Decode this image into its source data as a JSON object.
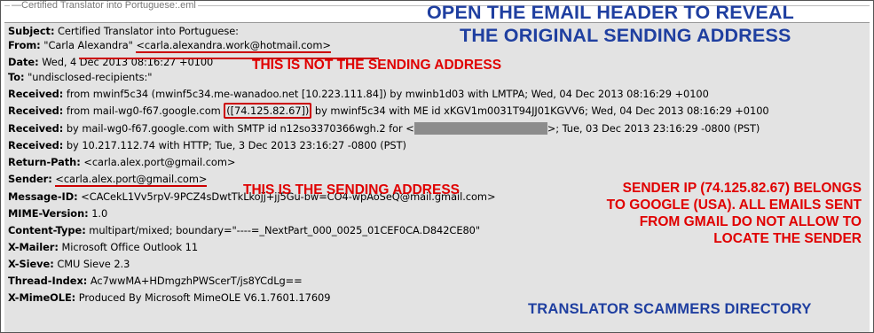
{
  "window": {
    "title": "Certified Translator into Portuguese:.eml"
  },
  "headers": [
    {
      "label": "Subject:",
      "value": "Certified Translator into Portuguese:"
    },
    {
      "label": "From:",
      "value": "\"Carla Alexandra\" ",
      "value2": "<carla.alexandra.work@hotmail.com>"
    },
    {
      "label": "Date:",
      "value": "Wed, 4 Dec 2013 08:16:27 +0100"
    },
    {
      "label": "To:",
      "value": "\"undisclosed-recipients:\""
    },
    {
      "label": "Received:",
      "value": "from mwinf5c34 (mwinf5c34.me-wanadoo.net [10.223.111.84]) by mwinb1d03 with LMTPA; Wed, 04 Dec 2013 08:16:29 +0100"
    },
    {
      "label": "Received:",
      "value": "from mail-wg0-f67.google.com ",
      "value2": "([74.125.82.67])",
      "value3": " by mwinf5c34 with ME id xKGV1m0031T94JJ01KGVV6; Wed, 04 Dec 2013 08:16:29 +0100"
    },
    {
      "label": "Received:",
      "value": "by mail-wg0-f67.google.com with SMTP id n12so3370366wgh.2 for <",
      "value3": ">; Tue, 03 Dec 2013 23:16:29 -0800 (PST)"
    },
    {
      "label": "Received:",
      "value": "by 10.217.112.74 with HTTP; Tue, 3 Dec 2013 23:16:27 -0800 (PST)"
    },
    {
      "label": "Return-Path:",
      "value": "<carla.alex.port@gmail.com>"
    },
    {
      "label": "Sender:",
      "value2": "<carla.alex.port@gmail.com>"
    },
    {
      "label": "Message-ID:",
      "value": "<CACekL1Vv5rpV-9PCZ4sDwtTkLkojj+jj5Gu-bw=CO4-wpAoSeQ@mail.gmail.com>"
    },
    {
      "label": "MIME-Version:",
      "value": "1.0"
    },
    {
      "label": "Content-Type:",
      "value": "multipart/mixed; boundary=\"----=_NextPart_000_0025_01CEF0CA.D842CE80\""
    },
    {
      "label": "X-Mailer:",
      "value": "Microsoft Office Outlook 11"
    },
    {
      "label": "X-Sieve:",
      "value": "CMU Sieve 2.3"
    },
    {
      "label": "Thread-Index:",
      "value": "Ac7wwMA+HDmgzhPWScerT/js8YCdLg=="
    },
    {
      "label": "X-MimeOLE:",
      "value": "Produced By Microsoft MimeOLE V6.1.7601.17609"
    }
  ],
  "annotations": {
    "open_header_line1": "OPEN THE EMAIL HEADER TO REVEAL",
    "open_header_line2": "THE ORIGINAL SENDING ADDRESS",
    "not_sending": "THIS IS NOT THE SENDING ADDRESS",
    "is_sending": "THIS IS THE SENDING ADDRESS",
    "sender_ip_line1": "SENDER IP (74.125.82.67) BELONGS",
    "sender_ip_line2": "TO GOOGLE (USA). ALL EMAILS SENT",
    "sender_ip_line3": "FROM GMAIL DO NOT ALLOW TO",
    "sender_ip_line4": "LOCATE THE SENDER",
    "directory": "TRANSLATOR SCAMMERS DIRECTORY"
  },
  "colors": {
    "red": "#e00000",
    "blue": "#1f3fa0",
    "header_bg": "#e3e3e3"
  }
}
